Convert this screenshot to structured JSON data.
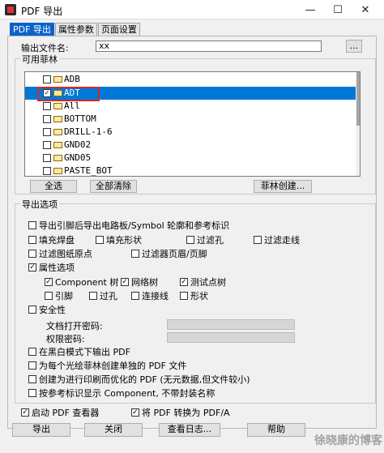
{
  "window": {
    "title": "PDF 导出",
    "controls": {
      "minimize": "—",
      "maximize": "☐",
      "close": "✕"
    }
  },
  "tabs": [
    {
      "label": "PDF 导出",
      "active": true
    },
    {
      "label": "属性参数",
      "active": false
    },
    {
      "label": "页面设置",
      "active": false
    }
  ],
  "output_file": {
    "label": "输出文件名:",
    "value": "xx",
    "browse_label": "..."
  },
  "available_layers": {
    "title": "可用菲林",
    "items": [
      {
        "label": "ADB",
        "checked": false,
        "selected": false
      },
      {
        "label": "ADT",
        "checked": true,
        "selected": true
      },
      {
        "label": "All",
        "checked": false,
        "selected": false
      },
      {
        "label": "BOTTOM",
        "checked": false,
        "selected": false
      },
      {
        "label": "DRILL-1-6",
        "checked": false,
        "selected": false
      },
      {
        "label": "GND02",
        "checked": false,
        "selected": false
      },
      {
        "label": "GND05",
        "checked": false,
        "selected": false
      },
      {
        "label": "PASTE_BOT",
        "checked": false,
        "selected": false
      }
    ],
    "select_all": "全选",
    "clear_all": "全部清除",
    "create_layer": "菲林创建..."
  },
  "export_options": {
    "title": "导出选项",
    "pin_board": {
      "label": "导出引脚后导出电路板/Symbol 轮廓和参考标识",
      "checked": false
    },
    "fill_pads": {
      "label": "填充焊盘",
      "checked": false
    },
    "fill_shapes": {
      "label": "填充形状",
      "checked": false
    },
    "filter_holes": {
      "label": "过滤孔",
      "checked": false
    },
    "filter_traces": {
      "label": "过滤走线",
      "checked": false
    },
    "filter_origin": {
      "label": "过滤图纸原点",
      "checked": false
    },
    "filter_header_footer": {
      "label": "过滤器页眉/页脚",
      "checked": false
    },
    "attribute_options": {
      "label": "属性选项",
      "checked": true
    },
    "component_tree": {
      "label": "Component 树",
      "checked": true
    },
    "net_tree": {
      "label": "网络树",
      "checked": true
    },
    "testpoint_tree": {
      "label": "测试点树",
      "checked": true
    },
    "pins": {
      "label": "引脚",
      "checked": false
    },
    "vias": {
      "label": "过孔",
      "checked": false
    },
    "connections": {
      "label": "连接线",
      "checked": false
    },
    "shapes": {
      "label": "形状",
      "checked": false
    },
    "security": {
      "label": "安全性",
      "checked": false
    },
    "open_password": {
      "label": "文档打开密码:",
      "value": ""
    },
    "permission_password": {
      "label": "权限密码:",
      "value": ""
    },
    "black_white": {
      "label": "在黑白模式下输出 PDF",
      "checked": false
    },
    "separate_pdf": {
      "label": "为每个光绘菲林创建单独的 PDF 文件",
      "checked": false
    },
    "print_optimized": {
      "label": "创建为进行印刷而优化的 PDF (无元数据,但文件较小)",
      "checked": false
    },
    "show_by_refdes": {
      "label": "按参考标识显示 Component, 不带封装名称",
      "checked": false
    }
  },
  "bottom": {
    "launch_viewer": {
      "label": "启动 PDF 查看器",
      "checked": true
    },
    "convert_pdfa": {
      "label": "将 PDF 转换为 PDF/A",
      "checked": true
    }
  },
  "buttons": {
    "export": "导出",
    "close": "关闭",
    "view_log": "查看日志...",
    "help": "帮助"
  },
  "watermark": "徐晓康的博客",
  "colors": {
    "selection": "#0078d7",
    "active_tab": "#0a63c9",
    "highlight": "#d62828"
  }
}
